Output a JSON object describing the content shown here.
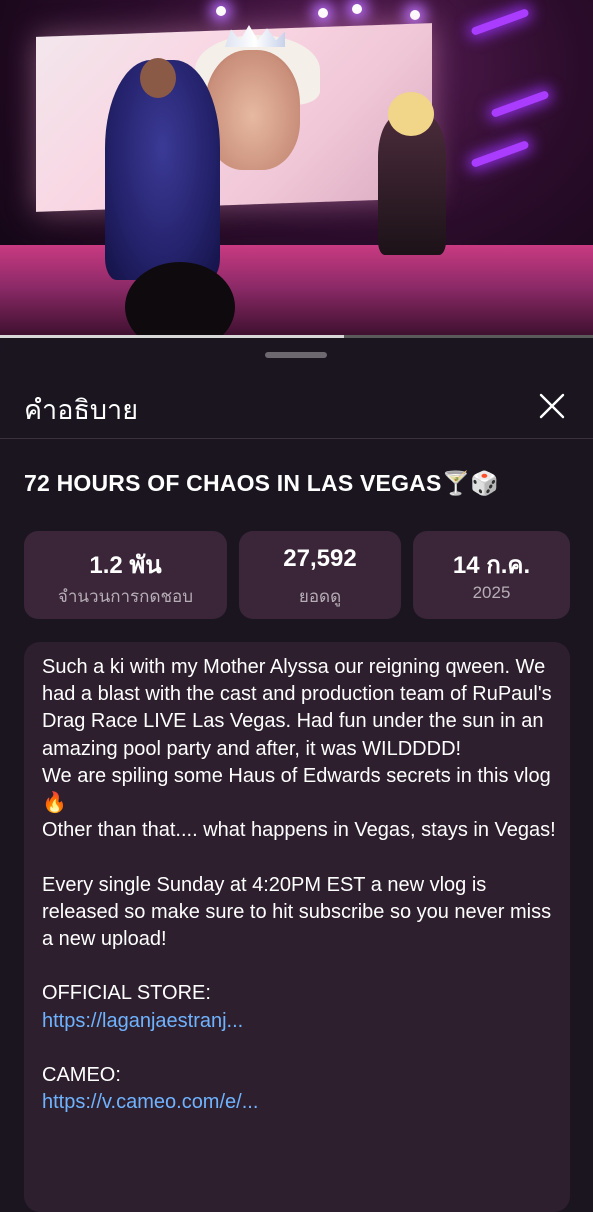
{
  "video": {
    "progress": 0.58
  },
  "sheet": {
    "title": "คำอธิบาย",
    "video_title": "72 HOURS OF CHAOS IN LAS VEGAS🍸🎲",
    "stats": [
      {
        "value": "1.2 พัน",
        "label": "จำนวนการกดชอบ"
      },
      {
        "value": "27,592",
        "label": "ยอดดู"
      },
      {
        "value": "14 ก.ค.",
        "label": "2025"
      }
    ],
    "description": {
      "lines": [
        "Such a ki with my Mother Alyssa our reigning qween.  We had a blast with the cast and production team of RuPaul's Drag Race LIVE Las Vegas. Had fun under the sun in an amazing pool party and after,  it was WILDDDD!",
        "We are spiling some Haus of Edwards secrets in this vlog 🔥",
        "Other than that.... what happens in Vegas, stays in Vegas!",
        "Every single Sunday at 4:20PM EST a new vlog is released so make sure to hit subscribe so you never miss a new upload!",
        "OFFICIAL STORE:",
        "CAMEO:"
      ],
      "links": [
        "https://laganjaestranj...",
        "https://v.cameo.com/e/..."
      ]
    }
  },
  "colors": {
    "background": "#1b1520",
    "card": "#3a2638",
    "description_card": "#2e1f2e",
    "link": "#6fb3ff"
  },
  "icons": {
    "close": "close-icon"
  }
}
